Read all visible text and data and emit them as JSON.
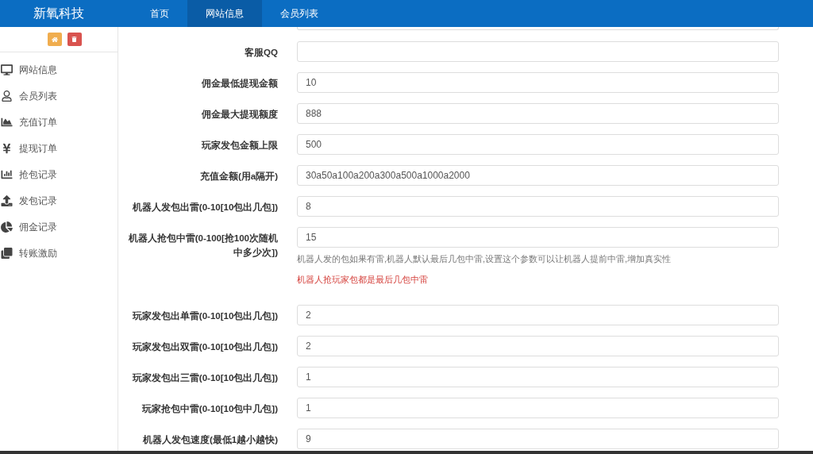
{
  "header": {
    "brand": "新氧科技",
    "nav": [
      {
        "label": "首页",
        "selected": false
      },
      {
        "label": "网站信息",
        "selected": true
      },
      {
        "label": "会员列表",
        "selected": false
      }
    ]
  },
  "sidebar": {
    "items": [
      {
        "label": "网站信息"
      },
      {
        "label": "会员列表"
      },
      {
        "label": "充值订单"
      },
      {
        "label": "提现订单"
      },
      {
        "label": "抢包记录"
      },
      {
        "label": "发包记录"
      },
      {
        "label": "佣金记录"
      },
      {
        "label": "转账激励"
      }
    ]
  },
  "form": {
    "fields": [
      {
        "label": "客服QQ"
      },
      {
        "label": "佣金最低提现金额",
        "value": "10"
      },
      {
        "label": "佣金最大提现额度",
        "value": "888"
      },
      {
        "label": "玩家发包金额上限",
        "value": "500"
      },
      {
        "label": "充值金额(用a隔开)",
        "value": "30a50a100a200a300a500a1000a2000"
      },
      {
        "label": "机器人发包出雷(0-10[10包出几包])",
        "value": "8"
      },
      {
        "label": "机器人抢包中雷(0-100[抢100次随机中多少次])",
        "value": "15",
        "help": "机器人发的包如果有雷,机器人默认最后几包中雷,设置这个参数可以让机器人提前中雷,增加真实性",
        "warning": "机器人抢玩家包都是最后几包中雷"
      },
      {
        "label": "玩家发包出单雷(0-10[10包出几包])",
        "value": "2"
      },
      {
        "label": "玩家发包出双雷(0-10[10包出几包])",
        "value": "2"
      },
      {
        "label": "玩家发包出三雷(0-10[10包出几包])",
        "value": "1"
      },
      {
        "label": "玩家抢包中雷(0-10[10包中几包])",
        "value": "1"
      },
      {
        "label": "机器人发包速度(最低1越小越快)",
        "value": "9"
      }
    ]
  }
}
